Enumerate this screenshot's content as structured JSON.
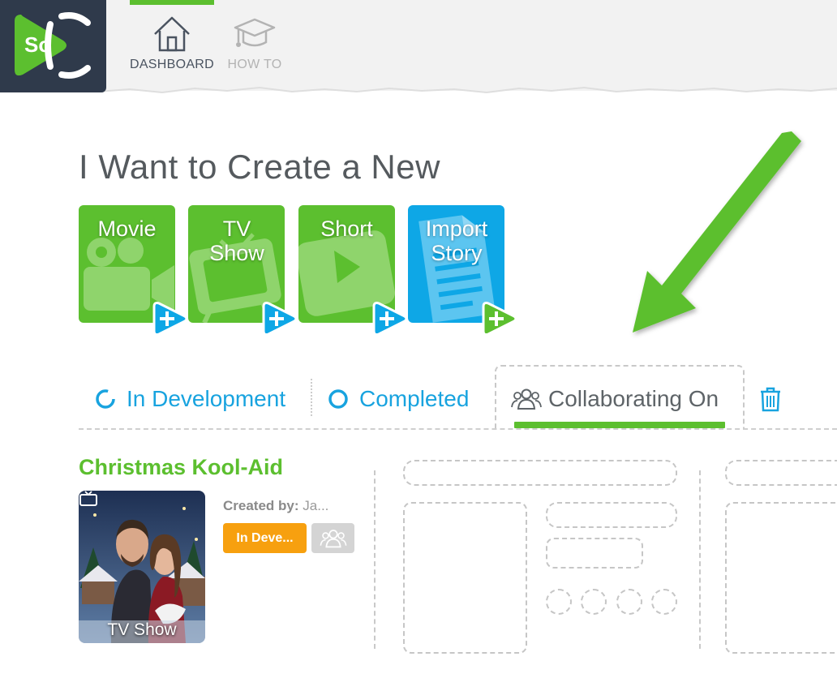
{
  "brand": {
    "logo_text": "So",
    "accent": "#5cbf2f",
    "blue": "#0ea7e6",
    "dark": "#2f3a4b",
    "orange": "#f7a00f"
  },
  "nav": {
    "dashboard": {
      "label": "DASHBOARD",
      "icon": "home-icon",
      "active": true
    },
    "howto": {
      "label": "HOW TO",
      "icon": "graduation-cap-icon",
      "active": false
    }
  },
  "create": {
    "heading": "I Want to Create a New",
    "tiles": [
      {
        "label": "Movie",
        "icon": "movie-camera-icon",
        "color": "green"
      },
      {
        "label": "TV Show",
        "icon": "tv-icon",
        "color": "green"
      },
      {
        "label": "Short",
        "icon": "play-icon",
        "color": "green"
      },
      {
        "label": "Import Story",
        "icon": "document-icon",
        "color": "blue"
      }
    ]
  },
  "tabs": {
    "in_development": "In Development",
    "completed": "Completed",
    "collaborating_on": "Collaborating On",
    "active": "collaborating_on",
    "trash_icon": "trash-icon"
  },
  "story": {
    "title": "Christmas Kool-Aid",
    "created_by_label": "Created by:",
    "author": "Ja...",
    "type": "TV Show",
    "status": "In Deve...",
    "collab_icon": "people-icon"
  }
}
